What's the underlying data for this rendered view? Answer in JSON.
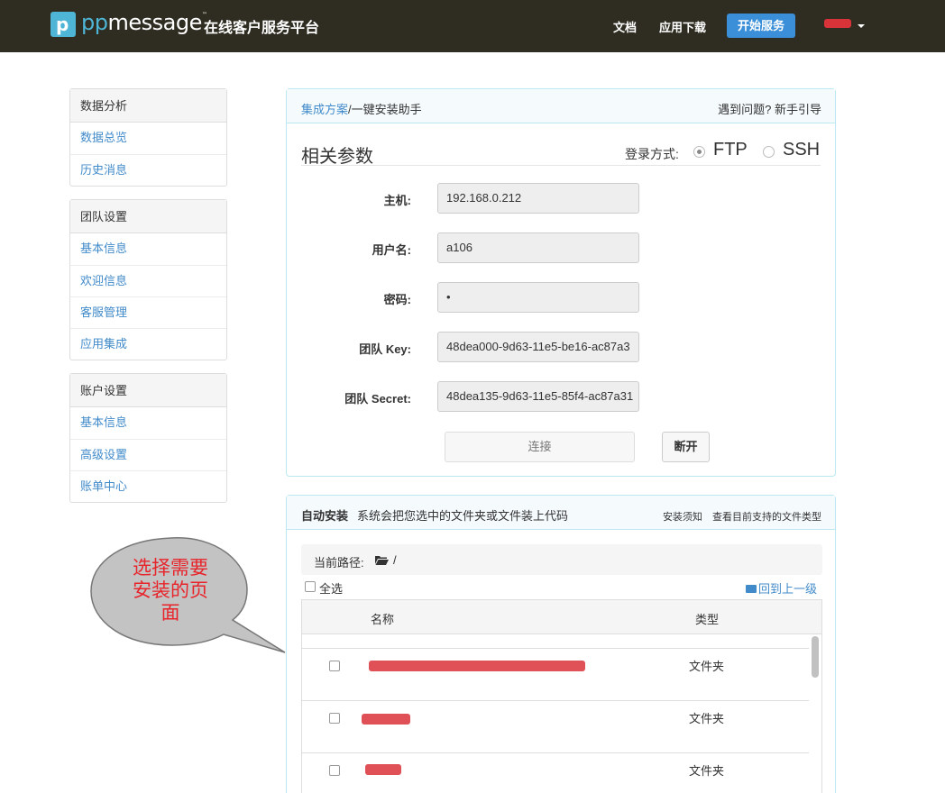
{
  "navbar": {
    "logo_letter": "p",
    "brand_pp": "pp",
    "brand_rest": "message",
    "brand_tm": "™",
    "tagline": "在线客户服务平台",
    "links": [
      "文档",
      "应用下载"
    ],
    "start_button": "开始服务"
  },
  "sidebar": {
    "groups": [
      {
        "title": "数据分析",
        "items": [
          "数据总览",
          "历史消息"
        ]
      },
      {
        "title": "团队设置",
        "items": [
          "基本信息",
          "欢迎信息",
          "客服管理",
          "应用集成"
        ]
      },
      {
        "title": "账户设置",
        "items": [
          "基本信息",
          "高级设置",
          "账单中心"
        ]
      }
    ]
  },
  "params_panel": {
    "crumb_link": "集成方案",
    "crumb_rest": "/一键安装助手",
    "help_question": "遇到问题?",
    "help_guide": "新手引导",
    "title": "相关参数",
    "login_mode_label": "登录方式:",
    "options": [
      "FTP",
      "SSH"
    ],
    "selected_option": "FTP",
    "fields": [
      {
        "label": "主机:",
        "value": "192.168.0.212"
      },
      {
        "label": "用户名:",
        "value": "a106"
      },
      {
        "label": "密码:",
        "value": "•"
      },
      {
        "label": "团队 Key:",
        "value": "48dea000-9d63-11e5-be16-ac87a3"
      },
      {
        "label": "团队 Secret:",
        "value": "48dea135-9d63-11e5-85f4-ac87a31"
      }
    ],
    "connect_button": "连接",
    "disconnect_button": "断开"
  },
  "auto_panel": {
    "title": "自动安装",
    "description": "系统会把您选中的文件夹或文件装上代码",
    "links": [
      "安装须知",
      "查看目前支持的文件类型"
    ],
    "current_path_label": "当前路径:",
    "current_path": "/",
    "select_all": "全选",
    "go_up": "回到上一级",
    "columns": [
      "名称",
      "类型"
    ],
    "rows": [
      {
        "type": "文件夹"
      },
      {
        "type": "文件夹"
      },
      {
        "type": "文件夹"
      }
    ]
  },
  "callout": {
    "text_lines": [
      "选择需要",
      "安装的页",
      "面"
    ]
  },
  "colors": {
    "navbar_bg": "#2f2d21",
    "brand_blue": "#4fb5d6",
    "primary_button": "#3a8fd8",
    "link": "#428bca",
    "redaction": "#d9333a",
    "callout_text": "#e8242b"
  }
}
